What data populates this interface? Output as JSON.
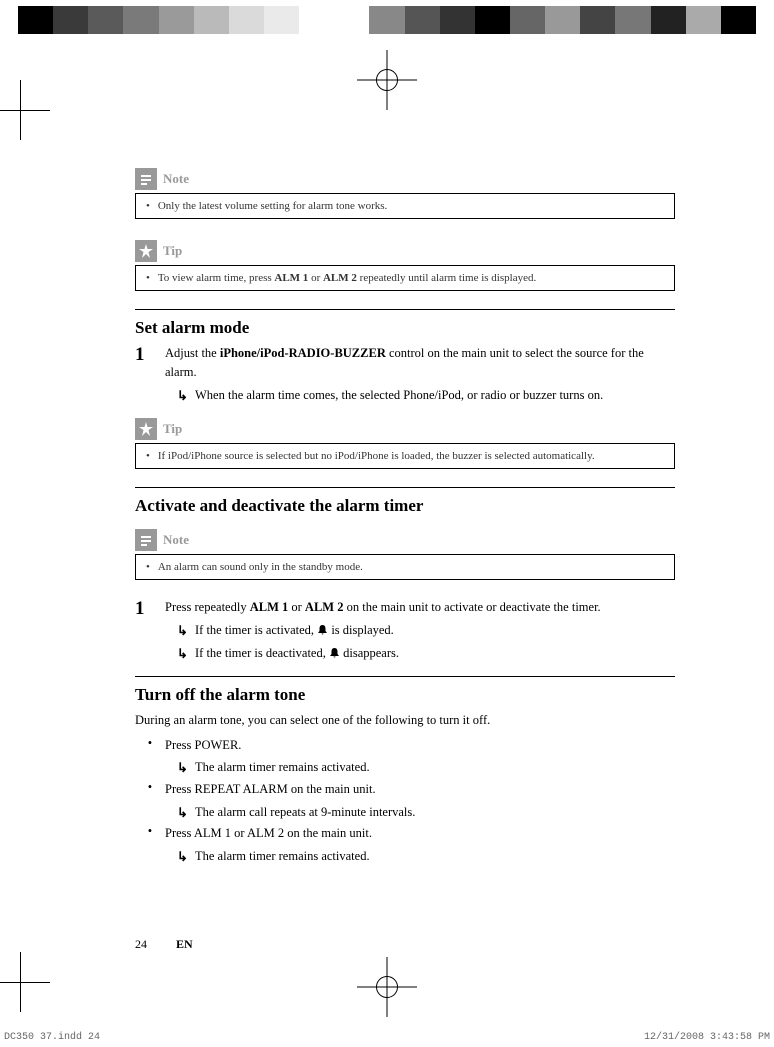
{
  "callouts": {
    "note1": {
      "title": "Note",
      "items": [
        "Only the latest volume setting for alarm tone works."
      ]
    },
    "tip1": {
      "title": "Tip",
      "items": [
        "To view alarm time, press ALM 1 or ALM 2 repeatedly until alarm time is displayed."
      ]
    },
    "tip2": {
      "title": "Tip",
      "items": [
        "If iPod/iPhone source is selected but no iPod/iPhone is loaded, the buzzer is selected automatically."
      ]
    },
    "note2": {
      "title": "Note",
      "items": [
        "An alarm can sound only in the standby mode."
      ]
    }
  },
  "sections": {
    "set_alarm": {
      "heading": "Set alarm mode",
      "step_num": "1",
      "step_pre": "Adjust the ",
      "step_bold": "iPhone/iPod-RADIO-BUZZER",
      "step_post": " control on the main unit to select the source for the alarm.",
      "sub1": "When the alarm time comes, the selected Phone/iPod, or radio or buzzer turns on."
    },
    "activate": {
      "heading": "Activate and deactivate the alarm timer",
      "step_num": "1",
      "step_text_pre": "Press repeatedly ",
      "step_b1": "ALM 1",
      "step_or": " or ",
      "step_b2": "ALM 2",
      "step_text_post": " on the main unit to activate or deactivate the timer.",
      "sub1_pre": "If the timer is activated, ",
      "sub1_post": " is displayed.",
      "sub2_pre": "If the timer is deactivated, ",
      "sub2_post": " disappears."
    },
    "turn_off": {
      "heading": "Turn off the alarm tone",
      "intro": "During an alarm tone, you can select one of the following to turn it off.",
      "items": [
        {
          "pre": "Press ",
          "bold": "POWER",
          "post": ".",
          "sub": "The alarm timer remains activated."
        },
        {
          "pre": "Press ",
          "bold": "REPEAT ALARM",
          "post": " on the main unit.",
          "sub": "The alarm call repeats at 9-minute intervals."
        },
        {
          "pre": "Press ",
          "bold": "ALM 1",
          "mid": " or ",
          "bold2": "ALM 2",
          "post": " on the main unit.",
          "sub": "The alarm timer remains activated."
        }
      ]
    }
  },
  "footer": {
    "page": "24",
    "lang": "EN"
  },
  "print_meta": {
    "file": "DC350 37.indd   24",
    "datetime": "12/31/2008   3:43:58 PM"
  },
  "color_bar": [
    "#000",
    "#3a3a3a",
    "#5a5a5a",
    "#7a7a7a",
    "#9a9a9a",
    "#bababa",
    "#dadada",
    "#eaeaea",
    "#fff",
    "#fff",
    "#888",
    "#555",
    "#333",
    "#000",
    "#666",
    "#999",
    "#444",
    "#777",
    "#222",
    "#aaa",
    "#000"
  ]
}
